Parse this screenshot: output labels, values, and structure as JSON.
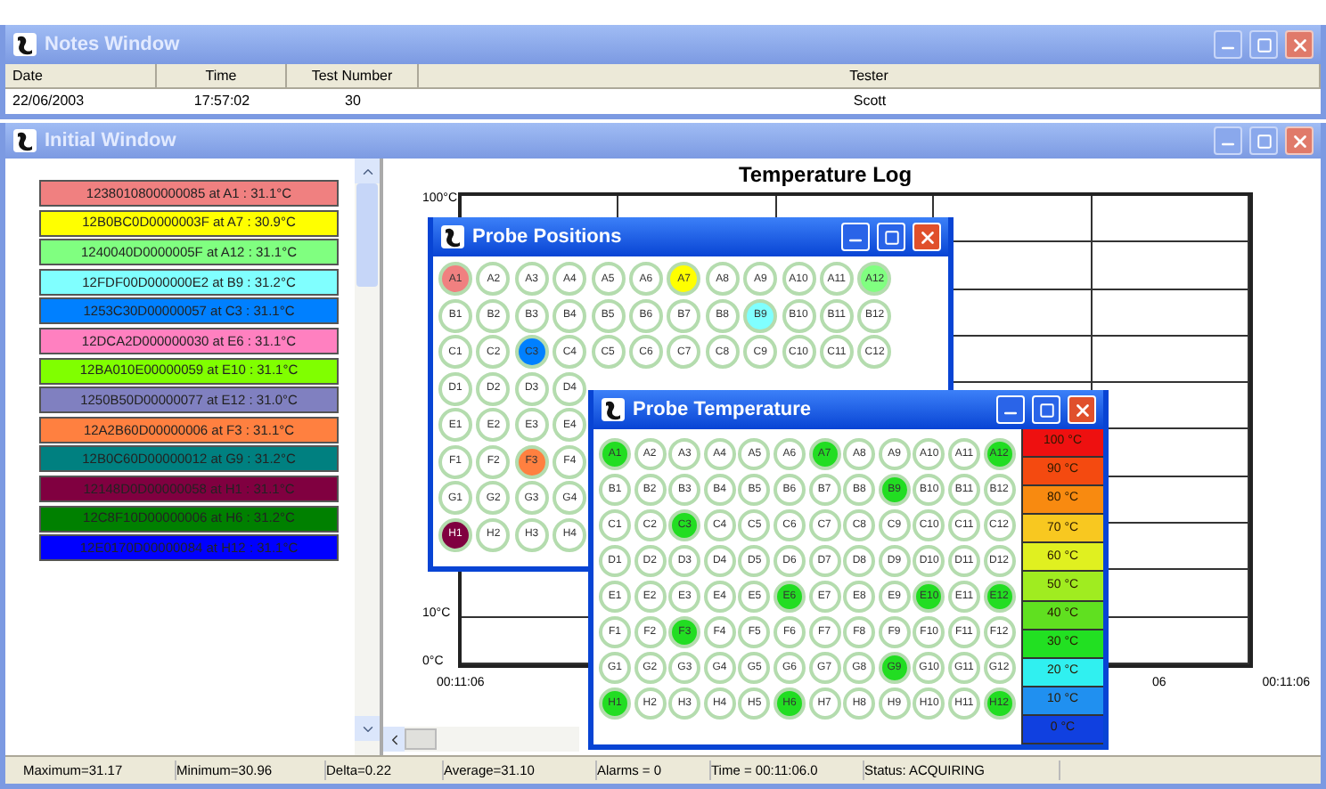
{
  "notes_window": {
    "title": "Notes Window",
    "active": false,
    "columns": [
      "Date",
      "Time",
      "Test Number",
      "Tester"
    ],
    "row": [
      "22/06/2003",
      "17:57:02",
      "30",
      "Scott"
    ]
  },
  "initial_window": {
    "title": "Initial Window",
    "active": false,
    "probes": [
      {
        "label": "1238010800000085 at A1 : 31.1°C",
        "color": "#f08080"
      },
      {
        "label": "12B0BC0D0000003F at A7 : 30.9°C",
        "color": "#ffff00"
      },
      {
        "label": "1240040D0000005F at A12 : 31.1°C",
        "color": "#80ff80"
      },
      {
        "label": "12FDF00D000000E2 at B9 : 31.2°C",
        "color": "#80ffff"
      },
      {
        "label": "1253C30D00000057 at C3 : 31.1°C",
        "color": "#0080ff"
      },
      {
        "label": "12DCA2D000000030 at E6 : 31.1°C",
        "color": "#ff80c0"
      },
      {
        "label": "12BA010E00000059 at E10 : 31.1°C",
        "color": "#80ff00"
      },
      {
        "label": "1250B50D00000077 at E12 : 31.0°C",
        "color": "#8080c0"
      },
      {
        "label": "12A2B60D00000006 at F3 : 31.1°C",
        "color": "#ff8040"
      },
      {
        "label": "12B0C60D00000012 at G9 : 31.2°C",
        "color": "#008080"
      },
      {
        "label": "12148D0D00000058 at H1 : 31.1°C",
        "color": "#800040"
      },
      {
        "label": "12C8F10D00000006 at H6 : 31.2°C",
        "color": "#008000"
      },
      {
        "label": "12E0170D00000084 at H12 : 31.1°C",
        "color": "#0000ff"
      }
    ],
    "chart": {
      "title": "Temperature Log",
      "y_labels": [
        "100°C",
        "10°C",
        "0°C"
      ],
      "x_labels": [
        "00:11:06",
        "06",
        "00:11:06"
      ]
    }
  },
  "probe_positions": {
    "title": "Probe Positions",
    "active": true,
    "rows": [
      {
        "cells": [
          {
            "label": "A1",
            "color": "#f08080"
          },
          {
            "label": "A2"
          },
          {
            "label": "A3"
          },
          {
            "label": "A4"
          },
          {
            "label": "A5"
          },
          {
            "label": "A6"
          },
          {
            "label": "A7",
            "color": "#ffff00"
          },
          {
            "label": "A8"
          },
          {
            "label": "A9"
          },
          {
            "label": "A10"
          },
          {
            "label": "A11"
          },
          {
            "label": "A12",
            "color": "#80ff80"
          }
        ]
      },
      {
        "cells": [
          {
            "label": "B1"
          },
          {
            "label": "B2"
          },
          {
            "label": "B3"
          },
          {
            "label": "B4"
          },
          {
            "label": "B5"
          },
          {
            "label": "B6"
          },
          {
            "label": "B7"
          },
          {
            "label": "B8"
          },
          {
            "label": "B9",
            "color": "#80ffff"
          },
          {
            "label": "B10"
          },
          {
            "label": "B11"
          },
          {
            "label": "B12"
          }
        ]
      },
      {
        "cells": [
          {
            "label": "C1"
          },
          {
            "label": "C2"
          },
          {
            "label": "C3",
            "color": "#0080ff"
          },
          {
            "label": "C4"
          },
          {
            "label": "C5"
          },
          {
            "label": "C6"
          },
          {
            "label": "C7"
          },
          {
            "label": "C8"
          },
          {
            "label": "C9"
          },
          {
            "label": "C10"
          },
          {
            "label": "C11"
          },
          {
            "label": "C12"
          }
        ]
      },
      {
        "cells": [
          {
            "label": "D1"
          },
          {
            "label": "D2"
          },
          {
            "label": "D3"
          },
          {
            "label": "D4"
          }
        ]
      },
      {
        "cells": [
          {
            "label": "E1"
          },
          {
            "label": "E2"
          },
          {
            "label": "E3"
          },
          {
            "label": "E4"
          }
        ]
      },
      {
        "cells": [
          {
            "label": "F1"
          },
          {
            "label": "F2"
          },
          {
            "label": "F3",
            "color": "#ff8040"
          },
          {
            "label": "F4"
          }
        ]
      },
      {
        "cells": [
          {
            "label": "G1"
          },
          {
            "label": "G2"
          },
          {
            "label": "G3"
          },
          {
            "label": "G4"
          }
        ]
      },
      {
        "cells": [
          {
            "label": "H1",
            "color": "#800040"
          },
          {
            "label": "H2"
          },
          {
            "label": "H3"
          },
          {
            "label": "H4"
          }
        ]
      }
    ]
  },
  "probe_temperature": {
    "title": "Probe Temperature",
    "active": true,
    "rows": [
      {
        "cells": [
          {
            "label": "A1",
            "color": "#22dd22"
          },
          {
            "label": "A2"
          },
          {
            "label": "A3"
          },
          {
            "label": "A4"
          },
          {
            "label": "A5"
          },
          {
            "label": "A6"
          },
          {
            "label": "A7",
            "color": "#22dd22"
          },
          {
            "label": "A8"
          },
          {
            "label": "A9"
          },
          {
            "label": "A10"
          },
          {
            "label": "A11"
          },
          {
            "label": "A12",
            "color": "#22dd22"
          }
        ]
      },
      {
        "cells": [
          {
            "label": "B1"
          },
          {
            "label": "B2"
          },
          {
            "label": "B3"
          },
          {
            "label": "B4"
          },
          {
            "label": "B5"
          },
          {
            "label": "B6"
          },
          {
            "label": "B7"
          },
          {
            "label": "B8"
          },
          {
            "label": "B9",
            "color": "#22dd22"
          },
          {
            "label": "B10"
          },
          {
            "label": "B11"
          },
          {
            "label": "B12"
          }
        ]
      },
      {
        "cells": [
          {
            "label": "C1"
          },
          {
            "label": "C2"
          },
          {
            "label": "C3",
            "color": "#22dd22"
          },
          {
            "label": "C4"
          },
          {
            "label": "C5"
          },
          {
            "label": "C6"
          },
          {
            "label": "C7"
          },
          {
            "label": "C8"
          },
          {
            "label": "C9"
          },
          {
            "label": "C10"
          },
          {
            "label": "C11"
          },
          {
            "label": "C12"
          }
        ]
      },
      {
        "cells": [
          {
            "label": "D1"
          },
          {
            "label": "D2"
          },
          {
            "label": "D3"
          },
          {
            "label": "D4"
          },
          {
            "label": "D5"
          },
          {
            "label": "D6"
          },
          {
            "label": "D7"
          },
          {
            "label": "D8"
          },
          {
            "label": "D9"
          },
          {
            "label": "D10"
          },
          {
            "label": "D11"
          },
          {
            "label": "D12"
          }
        ]
      },
      {
        "cells": [
          {
            "label": "E1"
          },
          {
            "label": "E2"
          },
          {
            "label": "E3"
          },
          {
            "label": "E4"
          },
          {
            "label": "E5"
          },
          {
            "label": "E6",
            "color": "#22dd22"
          },
          {
            "label": "E7"
          },
          {
            "label": "E8"
          },
          {
            "label": "E9"
          },
          {
            "label": "E10",
            "color": "#22dd22"
          },
          {
            "label": "E11"
          },
          {
            "label": "E12",
            "color": "#22dd22"
          }
        ]
      },
      {
        "cells": [
          {
            "label": "F1"
          },
          {
            "label": "F2"
          },
          {
            "label": "F3",
            "color": "#22dd22"
          },
          {
            "label": "F4"
          },
          {
            "label": "F5"
          },
          {
            "label": "F6"
          },
          {
            "label": "F7"
          },
          {
            "label": "F8"
          },
          {
            "label": "F9"
          },
          {
            "label": "F10"
          },
          {
            "label": "F11"
          },
          {
            "label": "F12"
          }
        ]
      },
      {
        "cells": [
          {
            "label": "G1"
          },
          {
            "label": "G2"
          },
          {
            "label": "G3"
          },
          {
            "label": "G4"
          },
          {
            "label": "G5"
          },
          {
            "label": "G6"
          },
          {
            "label": "G7"
          },
          {
            "label": "G8"
          },
          {
            "label": "G9",
            "color": "#22dd22"
          },
          {
            "label": "G10"
          },
          {
            "label": "G11"
          },
          {
            "label": "G12"
          }
        ]
      },
      {
        "cells": [
          {
            "label": "H1",
            "color": "#22dd22"
          },
          {
            "label": "H2"
          },
          {
            "label": "H3"
          },
          {
            "label": "H4"
          },
          {
            "label": "H5"
          },
          {
            "label": "H6",
            "color": "#22dd22"
          },
          {
            "label": "H7"
          },
          {
            "label": "H8"
          },
          {
            "label": "H9"
          },
          {
            "label": "H10"
          },
          {
            "label": "H11"
          },
          {
            "label": "H12",
            "color": "#22dd22"
          }
        ]
      }
    ],
    "legend": [
      {
        "label": "100 °C",
        "color": "#ee1010"
      },
      {
        "label": "90 °C",
        "color": "#f44a10"
      },
      {
        "label": "80 °C",
        "color": "#f88a10"
      },
      {
        "label": "70 °C",
        "color": "#f8c820"
      },
      {
        "label": "60 °C",
        "color": "#e0f020"
      },
      {
        "label": "50 °C",
        "color": "#a0ec20"
      },
      {
        "label": "40 °C",
        "color": "#60e020"
      },
      {
        "label": "30 °C",
        "color": "#22e022"
      },
      {
        "label": "20 °C",
        "color": "#30f0f0"
      },
      {
        "label": "10 °C",
        "color": "#2090f0"
      },
      {
        "label": "0 °C",
        "color": "#1040e0"
      }
    ]
  },
  "status_bar": [
    "Maximum=31.17",
    "Minimum=30.96",
    "Delta=0.22",
    "Average=31.10",
    "Alarms = 0",
    "Time = 00:11:06.0",
    "Status: ACQUIRING"
  ]
}
